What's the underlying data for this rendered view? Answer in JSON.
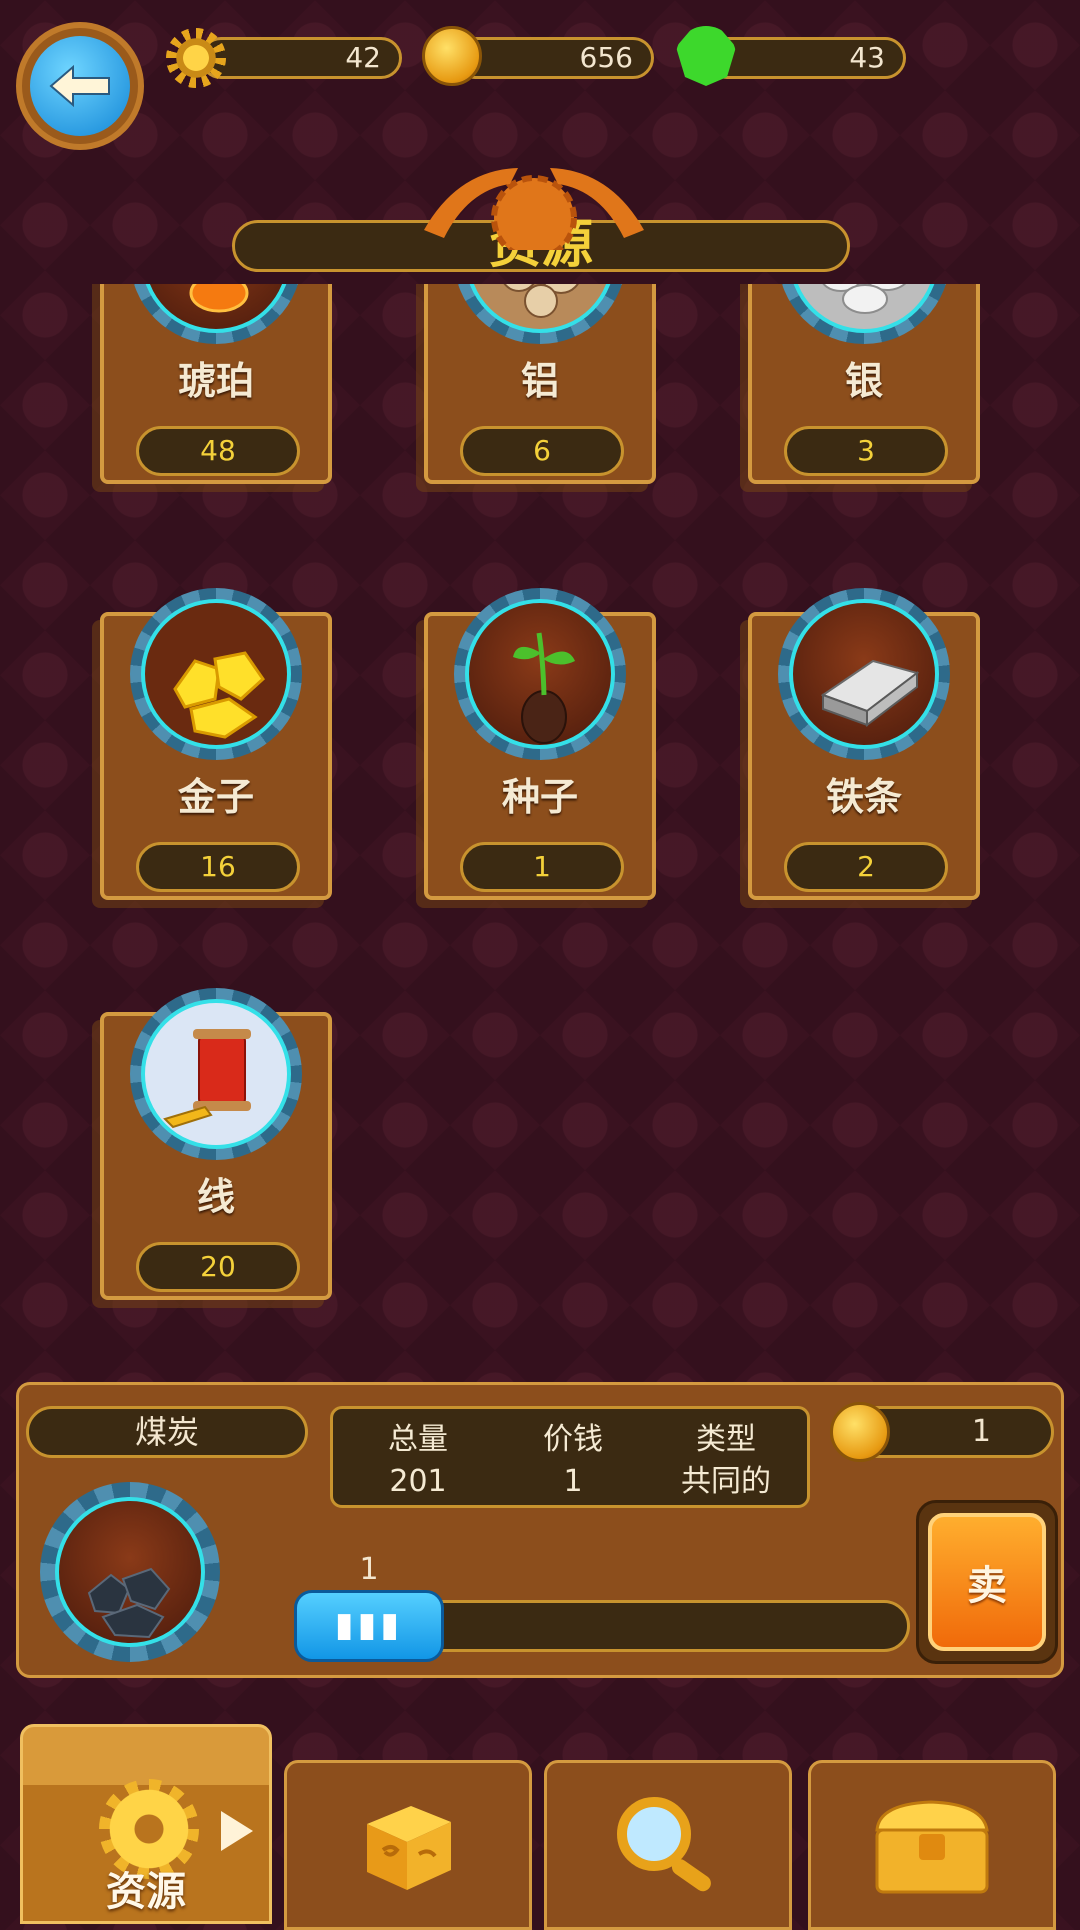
{
  "top_bar": {
    "gears": "42",
    "coins": "656",
    "gems": "43",
    "icons": [
      "back-arrow-icon",
      "gear-icon",
      "coin-icon",
      "gem-icon"
    ]
  },
  "header": {
    "title": "资源"
  },
  "resources": [
    {
      "name": "琥珀",
      "count": "48",
      "icon": "amber-icon"
    },
    {
      "name": "铝",
      "count": "6",
      "icon": "aluminum-ore-icon"
    },
    {
      "name": "银",
      "count": "3",
      "icon": "silver-ore-icon"
    },
    {
      "name": "金子",
      "count": "16",
      "icon": "gold-nuggets-icon"
    },
    {
      "name": "种子",
      "count": "1",
      "icon": "seed-sprout-icon"
    },
    {
      "name": "铁条",
      "count": "2",
      "icon": "iron-bar-icon"
    },
    {
      "name": "线",
      "count": "20",
      "icon": "thread-spool-icon"
    }
  ],
  "detail": {
    "selected_name": "煤炭",
    "stats_headers": [
      "总量",
      "价钱",
      "类型"
    ],
    "stats_values": [
      "201",
      "1",
      "共同的"
    ],
    "sell_price": "1",
    "slider_value": "1",
    "slider_fraction": 0.0,
    "sell_label": "卖"
  },
  "bottom_tabs": [
    {
      "label": "资源",
      "icon": "gear-icon",
      "active": true
    },
    {
      "label": "",
      "icon": "dice-cube-icon",
      "active": false
    },
    {
      "label": "",
      "icon": "magnifier-icon",
      "active": false
    },
    {
      "label": "",
      "icon": "treasure-chest-icon",
      "active": false
    }
  ],
  "colors": {
    "background": "#3a1220",
    "card": "#8c4e1c",
    "card_border": "#d49a40",
    "count_text": "#f4d13a",
    "accent_blue": "#1296e6",
    "sell_orange": "#f06a0a"
  }
}
